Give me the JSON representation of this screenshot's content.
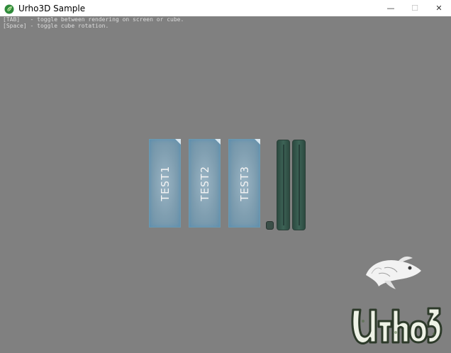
{
  "window": {
    "title": "Urho3D Sample",
    "icon": "urho-leaf-icon",
    "controls": {
      "minimize_glyph": "—",
      "maximize_glyph": "☐",
      "close_glyph": "✕"
    }
  },
  "instructions": [
    "[TAB]   - toggle between rendering on screen or cube.",
    "[Space] - toggle cube rotation."
  ],
  "panels": [
    {
      "label": "TEST1"
    },
    {
      "label": "TEST2"
    },
    {
      "label": "TEST3"
    }
  ],
  "colors": {
    "viewport_background": "#808080",
    "panel_border": "#6a9ab2",
    "slider_fill": "#3d6356"
  },
  "logos": {
    "fish": "urho-fish-logo",
    "wordmark": "Urho3D"
  }
}
